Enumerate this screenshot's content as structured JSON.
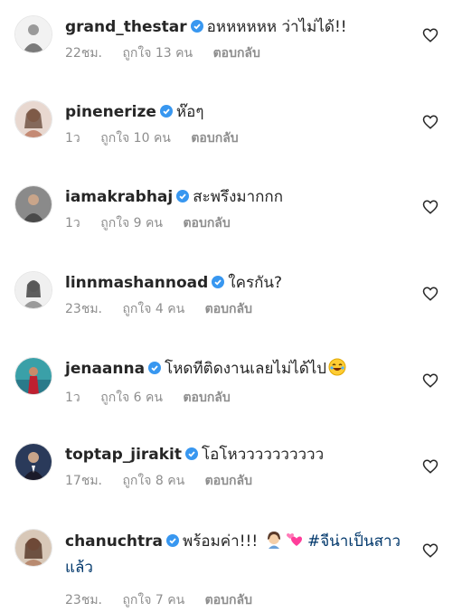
{
  "comments": [
    {
      "username": "grand_thestar",
      "text": "อหหหหหห ว่าไม่ได้!!",
      "time": "22ชม.",
      "likes": "ถูกใจ 13 คน",
      "reply": "ตอบกลับ",
      "avatar_icon": "avatar-person"
    },
    {
      "username": "pinenerize",
      "text": "ห๊อๆ",
      "time": "1ว",
      "likes": "ถูกใจ 10 คน",
      "reply": "ตอบกลับ",
      "avatar_icon": "avatar-person"
    },
    {
      "username": "iamakrabhaj",
      "text": "สะพรึงมากกก",
      "time": "1ว",
      "likes": "ถูกใจ 9 คน",
      "reply": "ตอบกลับ",
      "avatar_icon": "avatar-person"
    },
    {
      "username": "linnmashannoad",
      "text": "ใครกัน?",
      "time": "23ชม.",
      "likes": "ถูกใจ 4 คน",
      "reply": "ตอบกลับ",
      "avatar_icon": "avatar-person"
    },
    {
      "username": "jenaanna",
      "text": "โหดทีติดงานเลยไม่ได้ไป",
      "time": "1ว",
      "likes": "ถูกใจ 6 คน",
      "reply": "ตอบกลับ",
      "avatar_icon": "avatar-person",
      "emoji": "laughing-emoji"
    },
    {
      "username": "toptap_jirakit",
      "text": "โอโหวววววววววว",
      "time": "17ชม.",
      "likes": "ถูกใจ 8 คน",
      "reply": "ตอบกลับ",
      "avatar_icon": "avatar-person"
    },
    {
      "username": "chanuchtra",
      "text": "พร้อมค่า!!!",
      "hashtag": "#จีน่าเป็นสาวแล้ว",
      "time": "23ชม.",
      "likes": "ถูกใจ 7 คน",
      "reply": "ตอบกลับ",
      "avatar_icon": "avatar-person",
      "emoji": "woman-and-hearts-emoji"
    }
  ],
  "colors": {
    "verified": "#3897f0",
    "meta": "#8e8e8e",
    "hashtag": "#00376b"
  }
}
